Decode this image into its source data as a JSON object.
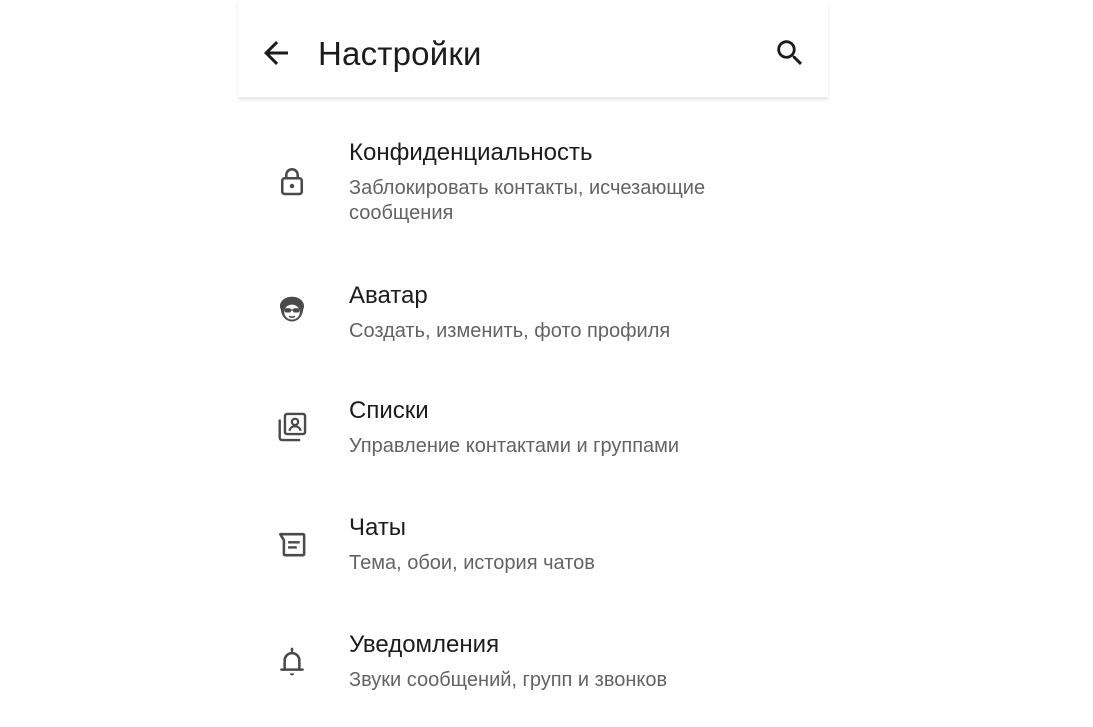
{
  "header": {
    "title": "Настройки",
    "back_icon": "arrow-back-icon",
    "search_icon": "search-icon"
  },
  "colors": {
    "text_primary": "#1c1c1c",
    "text_secondary": "#636363",
    "icon": "#4a4a4a",
    "background": "#ffffff"
  },
  "settings": {
    "items": [
      {
        "icon": "lock-icon",
        "label": "Конфиденциальность",
        "subtitle": "Заблокировать контакты, исчезающие сообщения"
      },
      {
        "icon": "avatar-icon",
        "label": "Аватар",
        "subtitle": "Создать, изменить, фото профиля"
      },
      {
        "icon": "contact-list-icon",
        "label": "Списки",
        "subtitle": "Управление контактами и группами"
      },
      {
        "icon": "chat-icon",
        "label": "Чаты",
        "subtitle": "Тема, обои, история чатов"
      },
      {
        "icon": "bell-icon",
        "label": "Уведомления",
        "subtitle": "Звуки сообщений, групп и звонков"
      }
    ]
  }
}
